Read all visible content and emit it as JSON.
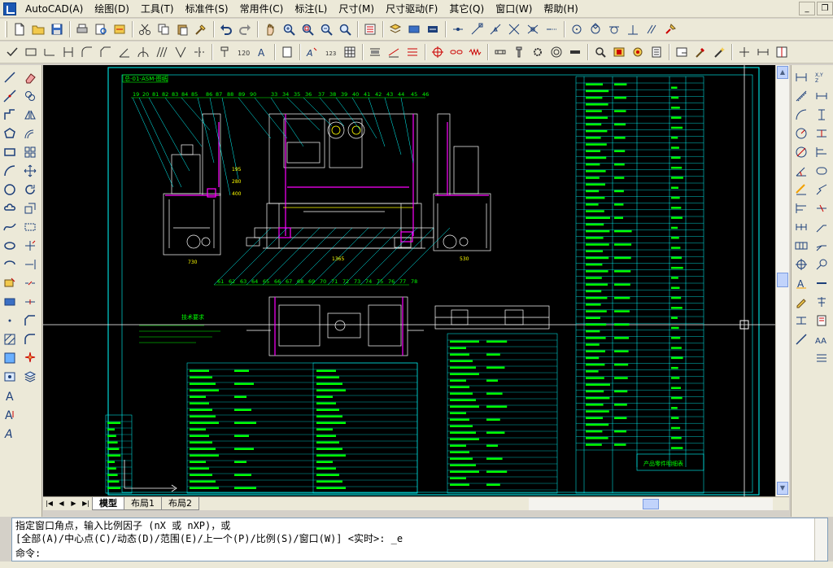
{
  "menu": {
    "items": [
      "AutoCAD(A)",
      "绘图(D)",
      "工具(T)",
      "标准件(S)",
      "常用件(C)",
      "标注(L)",
      "尺寸(M)",
      "尺寸驱动(F)",
      "其它(Q)",
      "窗口(W)",
      "帮助(H)"
    ]
  },
  "window_controls": {
    "minimize": "_",
    "restore": "❐",
    "close": "✕"
  },
  "layout_tabs": {
    "model": "模型",
    "layout1": "布局1",
    "layout2": "布局2"
  },
  "nav_buttons": {
    "first": "|◀",
    "prev": "◀",
    "next": "▶",
    "last": "▶|"
  },
  "drawing": {
    "frame_title": "总-01-ASM-图纸",
    "section_label": "技术要求",
    "table_title": "产品零件明细表",
    "balloon_numbers_top": [
      "19",
      "20",
      "81",
      "82",
      "83",
      "84",
      "85",
      "86",
      "87",
      "88",
      "89",
      "90",
      "91",
      "92",
      "93",
      "94",
      "95",
      "96",
      "97",
      "98",
      "39",
      "40",
      "41",
      "42",
      "43",
      "44",
      "45",
      "46"
    ],
    "balloon_numbers_mid": [
      "61",
      "62",
      "63",
      "64",
      "65",
      "66",
      "67",
      "68",
      "69",
      "70",
      "71",
      "72",
      "73",
      "74",
      "75",
      "76",
      "77",
      "78",
      "79",
      "80"
    ],
    "dim_values": [
      "730",
      "1365",
      "530",
      "195",
      "280",
      "400"
    ]
  },
  "command": {
    "line1": "指定窗口角点，输入比例因子 (nX 或 nXP)，或",
    "line2": "[全部(A)/中心点(C)/动态(D)/范围(E)/上一个(P)/比例(S)/窗口(W)] <实时>: _e",
    "line3": "命令:"
  },
  "colors": {
    "canvas": "#000000",
    "frame": "#00ffff",
    "geometry": "#ffffff",
    "highlight": "#ff00ff",
    "text": "#00ff00",
    "dimension": "#ffff00",
    "red_line": "#ff0000"
  }
}
